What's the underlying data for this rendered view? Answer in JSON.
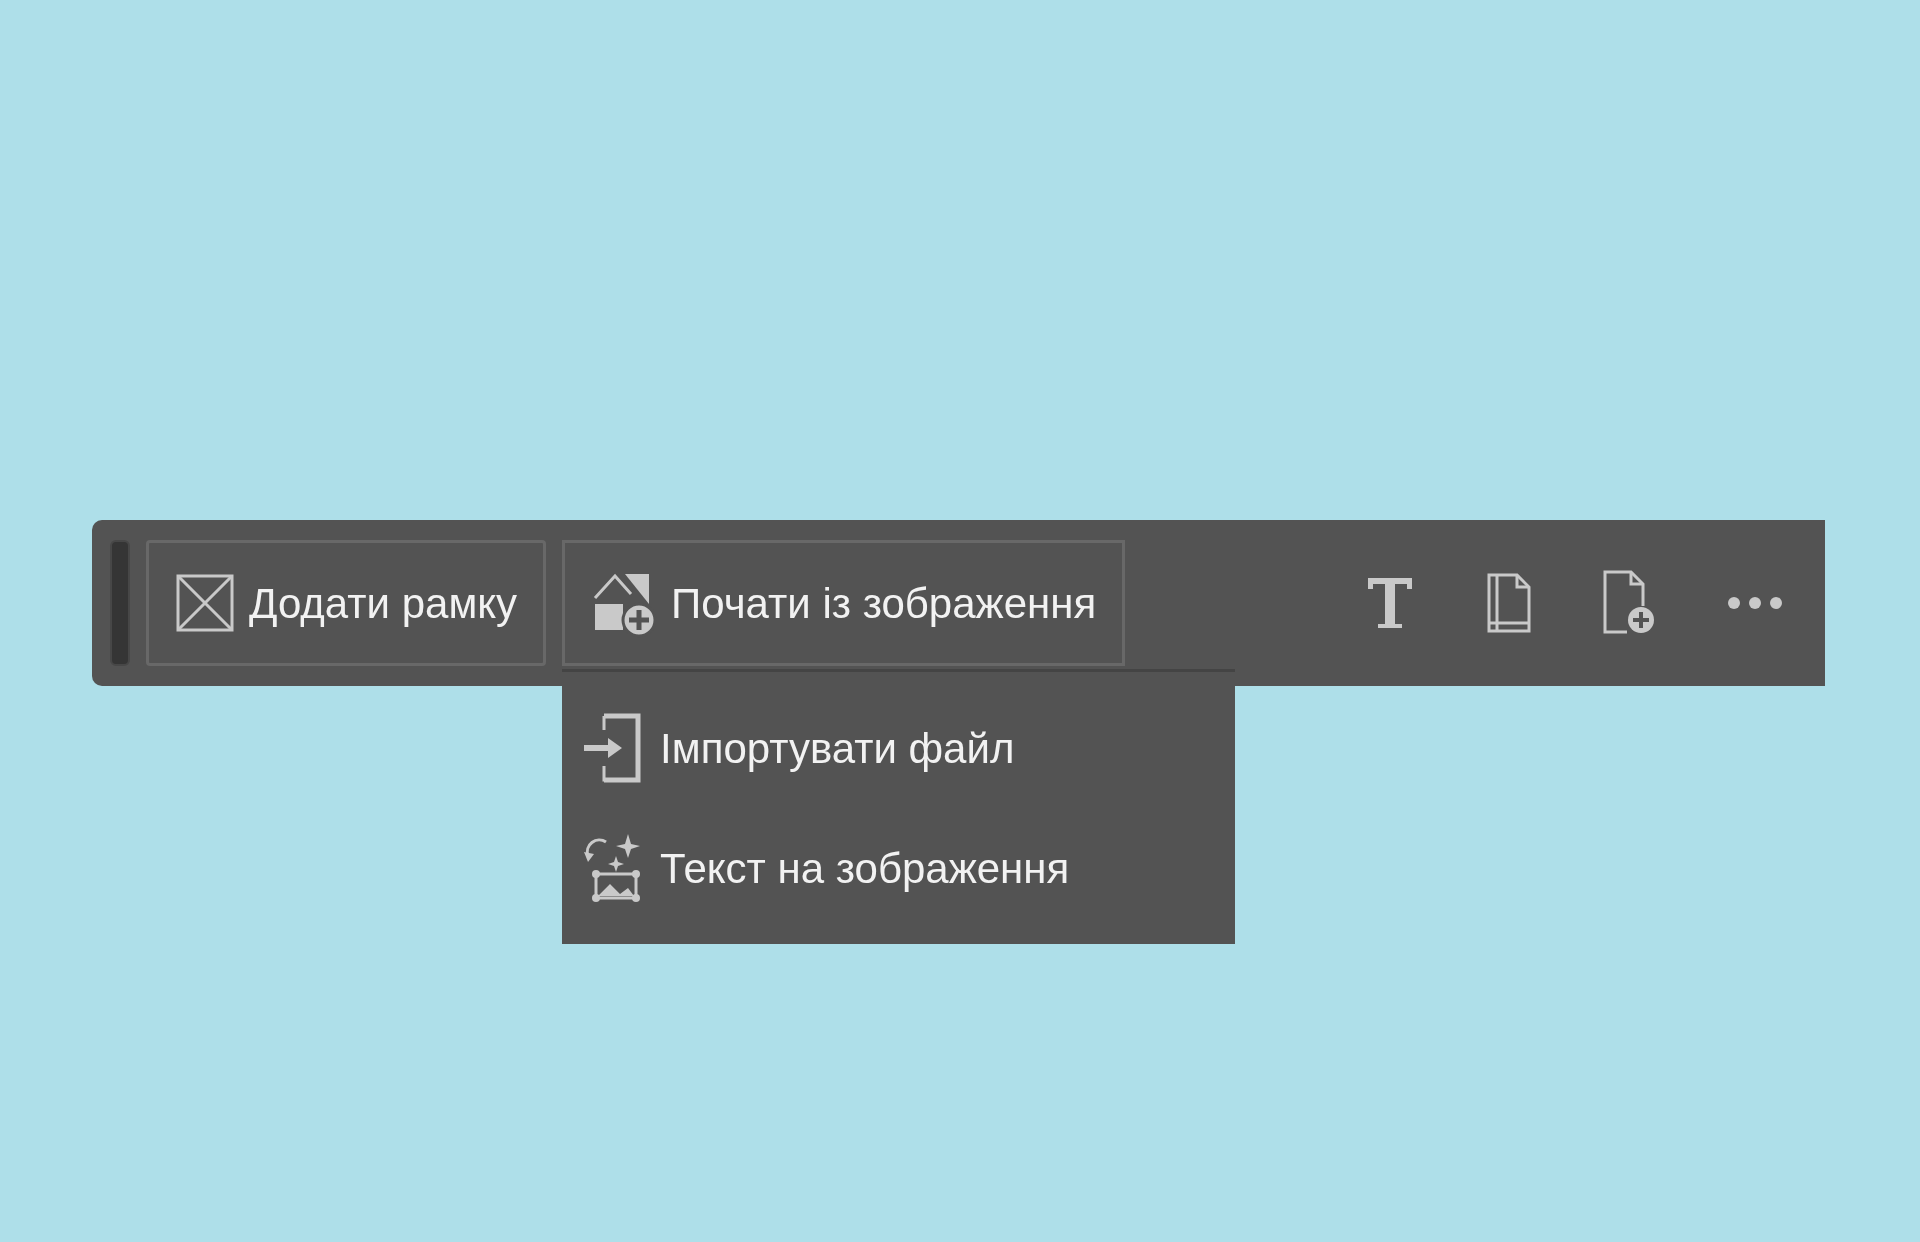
{
  "toolbar": {
    "buttons": [
      {
        "label": "Додати рамку",
        "expanded": false
      },
      {
        "label": "Почати із зображення",
        "expanded": true
      }
    ]
  },
  "menu": {
    "items": [
      {
        "label": "Імпортувати файл"
      },
      {
        "label": "Текст на зображення"
      }
    ]
  }
}
